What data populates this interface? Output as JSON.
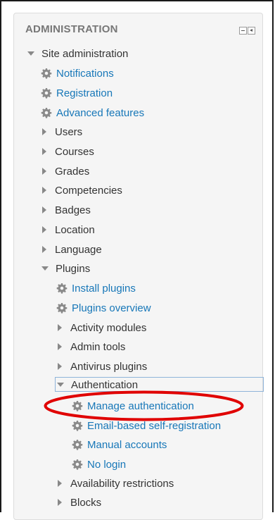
{
  "block": {
    "title": "ADMINISTRATION",
    "controls": [
      "minimize-icon",
      "dock-icon"
    ]
  },
  "tree": {
    "site_admin": "Site administration",
    "notifications": "Notifications",
    "registration": "Registration",
    "advanced_features": "Advanced features",
    "users": "Users",
    "courses": "Courses",
    "grades": "Grades",
    "competencies": "Competencies",
    "badges": "Badges",
    "location": "Location",
    "language": "Language",
    "plugins": "Plugins",
    "install_plugins": "Install plugins",
    "plugins_overview": "Plugins overview",
    "activity_modules": "Activity modules",
    "admin_tools": "Admin tools",
    "antivirus_plugins": "Antivirus plugins",
    "authentication": "Authentication",
    "manage_authentication": "Manage authentication",
    "email_self_registration": "Email-based self-registration",
    "manual_accounts": "Manual accounts",
    "no_login": "No login",
    "availability_restrictions": "Availability restrictions",
    "blocks": "Blocks"
  },
  "colors": {
    "link": "#1777b8",
    "text": "#333333",
    "header": "#777777",
    "highlight": "#e00000"
  }
}
